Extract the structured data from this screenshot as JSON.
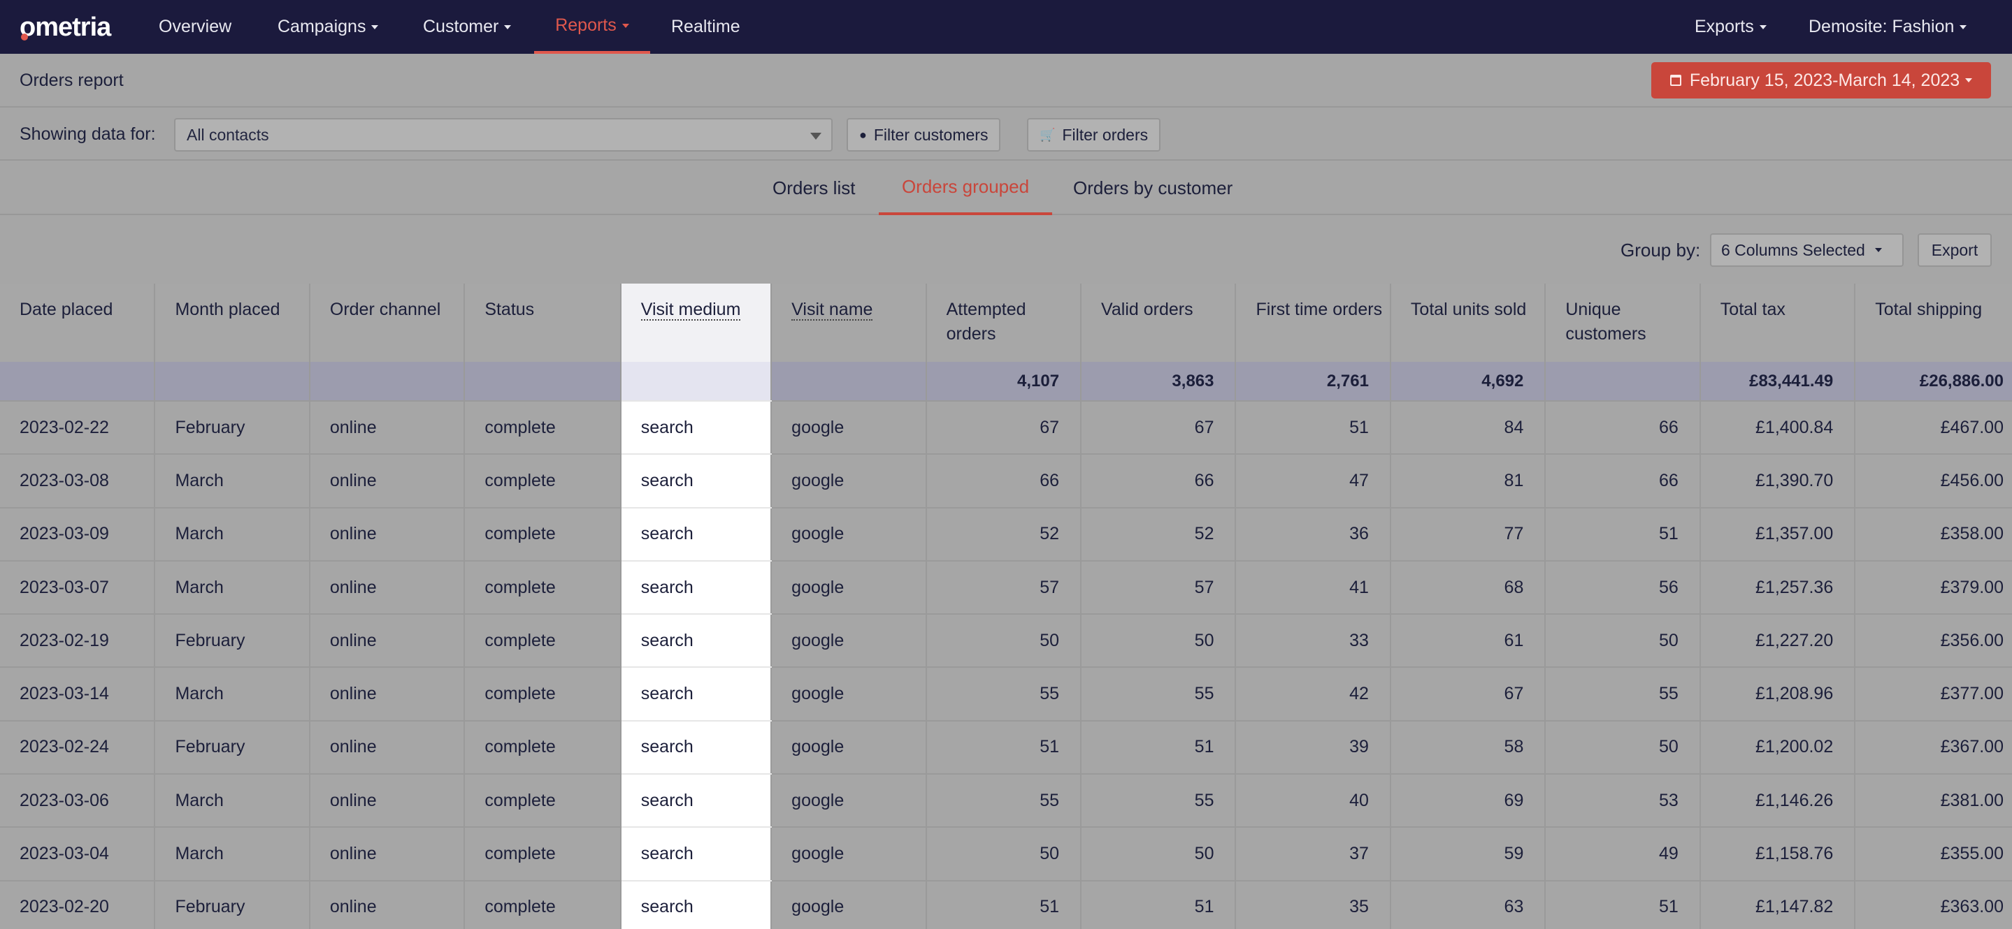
{
  "nav": {
    "logo": "ometria",
    "items": [
      {
        "label": "Overview",
        "caret": false
      },
      {
        "label": "Campaigns",
        "caret": true
      },
      {
        "label": "Customer",
        "caret": true
      },
      {
        "label": "Reports",
        "caret": true,
        "active": true
      },
      {
        "label": "Realtime",
        "caret": false
      }
    ],
    "right": [
      {
        "label": "Exports",
        "caret": true
      },
      {
        "label": "Demosite: Fashion",
        "caret": true
      }
    ]
  },
  "report": {
    "title": "Orders report",
    "date_range": "February 15, 2023-March 14, 2023"
  },
  "filters": {
    "showing_label": "Showing data for:",
    "contacts_value": "All contacts",
    "filter_customers": "Filter customers",
    "filter_orders": "Filter orders"
  },
  "tabs": [
    {
      "label": "Orders list"
    },
    {
      "label": "Orders grouped",
      "active": true
    },
    {
      "label": "Orders by customer"
    }
  ],
  "group": {
    "label": "Group by:",
    "selected": "6 Columns Selected",
    "export": "Export"
  },
  "table": {
    "columns": [
      "Date placed",
      "Month placed",
      "Order channel",
      "Status",
      "Visit medium",
      "Visit name",
      "Attempted orders",
      "Valid orders",
      "First time orders",
      "Total units sold",
      "Unique customers",
      "Total tax",
      "Total shipping"
    ],
    "totals": [
      "",
      "",
      "",
      "",
      "",
      "",
      "4,107",
      "3,863",
      "2,761",
      "4,692",
      "",
      "£83,441.49",
      "£26,886.00"
    ],
    "rows": [
      [
        "2023-02-22",
        "February",
        "online",
        "complete",
        "search",
        "google",
        "67",
        "67",
        "51",
        "84",
        "66",
        "£1,400.84",
        "£467.00"
      ],
      [
        "2023-03-08",
        "March",
        "online",
        "complete",
        "search",
        "google",
        "66",
        "66",
        "47",
        "81",
        "66",
        "£1,390.70",
        "£456.00"
      ],
      [
        "2023-03-09",
        "March",
        "online",
        "complete",
        "search",
        "google",
        "52",
        "52",
        "36",
        "77",
        "51",
        "£1,357.00",
        "£358.00"
      ],
      [
        "2023-03-07",
        "March",
        "online",
        "complete",
        "search",
        "google",
        "57",
        "57",
        "41",
        "68",
        "56",
        "£1,257.36",
        "£379.00"
      ],
      [
        "2023-02-19",
        "February",
        "online",
        "complete",
        "search",
        "google",
        "50",
        "50",
        "33",
        "61",
        "50",
        "£1,227.20",
        "£356.00"
      ],
      [
        "2023-03-14",
        "March",
        "online",
        "complete",
        "search",
        "google",
        "55",
        "55",
        "42",
        "67",
        "55",
        "£1,208.96",
        "£377.00"
      ],
      [
        "2023-02-24",
        "February",
        "online",
        "complete",
        "search",
        "google",
        "51",
        "51",
        "39",
        "58",
        "50",
        "£1,200.02",
        "£367.00"
      ],
      [
        "2023-03-06",
        "March",
        "online",
        "complete",
        "search",
        "google",
        "55",
        "55",
        "40",
        "69",
        "53",
        "£1,146.26",
        "£381.00"
      ],
      [
        "2023-03-04",
        "March",
        "online",
        "complete",
        "search",
        "google",
        "50",
        "50",
        "37",
        "59",
        "49",
        "£1,158.76",
        "£355.00"
      ],
      [
        "2023-02-20",
        "February",
        "online",
        "complete",
        "search",
        "google",
        "51",
        "51",
        "35",
        "63",
        "51",
        "£1,147.82",
        "£363.00"
      ]
    ]
  },
  "colors": {
    "nav_bg": "#1b1a3d",
    "accent": "#c9463b",
    "overlay_gray": "#a6a6a6",
    "highlight_column": "#ffffff"
  }
}
